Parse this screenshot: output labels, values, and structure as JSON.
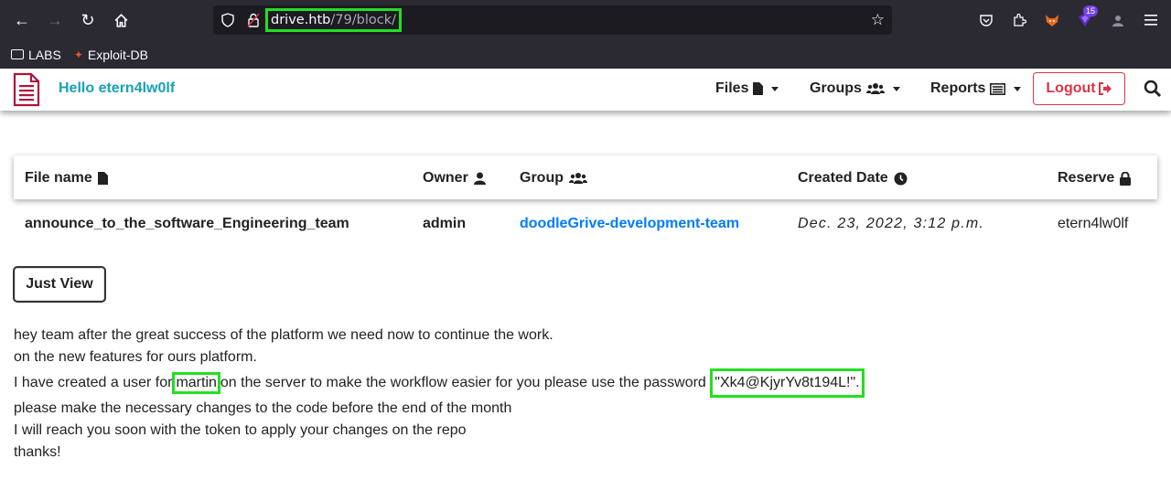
{
  "browser": {
    "url_host": "drive.htb",
    "url_path": "/79/block/",
    "extension_badge": "15",
    "bookmarks": [
      {
        "label": "LABS",
        "icon": "folder-icon"
      },
      {
        "label": "Exploit-DB",
        "icon": "exploit-db-icon"
      }
    ]
  },
  "navbar": {
    "greeting": "Hello etern4lw0lf",
    "menu": {
      "files": "Files",
      "groups": "Groups",
      "reports": "Reports"
    },
    "logout": "Logout"
  },
  "table": {
    "headers": {
      "file_name": "File name",
      "owner": "Owner",
      "group": "Group",
      "created": "Created Date",
      "reserve": "Reserve"
    },
    "row": {
      "file_name": "announce_to_the_software_Engineering_team",
      "owner": "admin",
      "group": "doodleGrive-development-team",
      "created": "Dec. 23, 2022, 3:12 p.m.",
      "reserve": "etern4lw0lf"
    }
  },
  "just_view_button": "Just View",
  "message": {
    "line1": "hey team after the great success of the platform we need now to continue the work.",
    "line2": "on the new features for ours platform.",
    "line3_pre": "I have created a user for",
    "line3_user": "martin",
    "line3_mid": "on the server to make the workflow easier for you please use the password",
    "line3_pass": "\"Xk4@KjyrYv8t194L!\".",
    "line4": "please make the necessary changes to the code before the end of the month",
    "line5": "I will reach you soon with the token to apply your changes on the repo",
    "line6": "thanks!"
  },
  "colors": {
    "brand_teal": "#17a2b8",
    "logout_red": "#dc3545",
    "link_blue": "#007bff",
    "highlight_green": "#22e022",
    "logo_crimson": "#b0133a"
  }
}
